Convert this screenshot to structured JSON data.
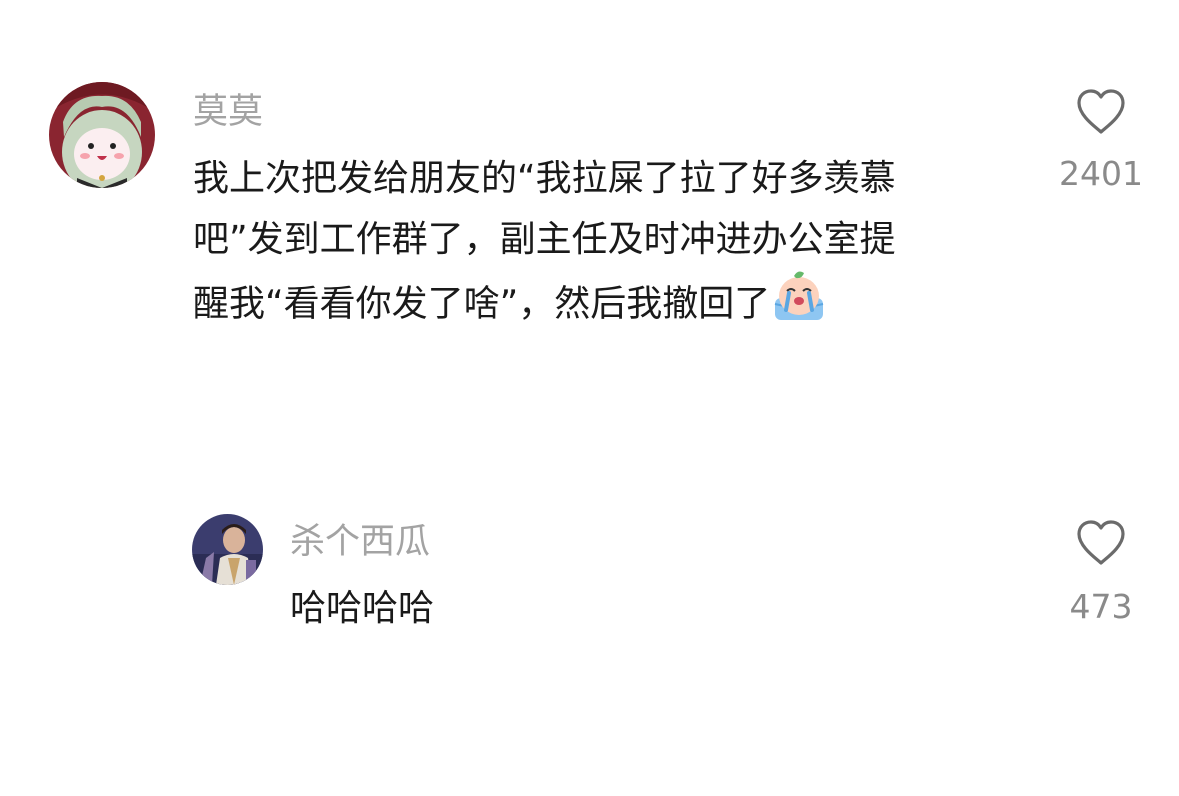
{
  "comments": [
    {
      "username": "莫莫",
      "lines": [
        "我上次把发给朋友的“我拉屎了拉了好多羡慕",
        "吧”发到工作群了，副主任及时冲进办公室提",
        "醒我“看看你发了啥”，然后我撤回了"
      ],
      "emoji": "crying-emoji-icon",
      "like_count": "2401",
      "like_icon": "heart-outline-icon"
    },
    {
      "username": "杀个西瓜",
      "lines": [
        "哈哈哈哈"
      ],
      "like_count": "473",
      "like_icon": "heart-outline-icon"
    }
  ]
}
